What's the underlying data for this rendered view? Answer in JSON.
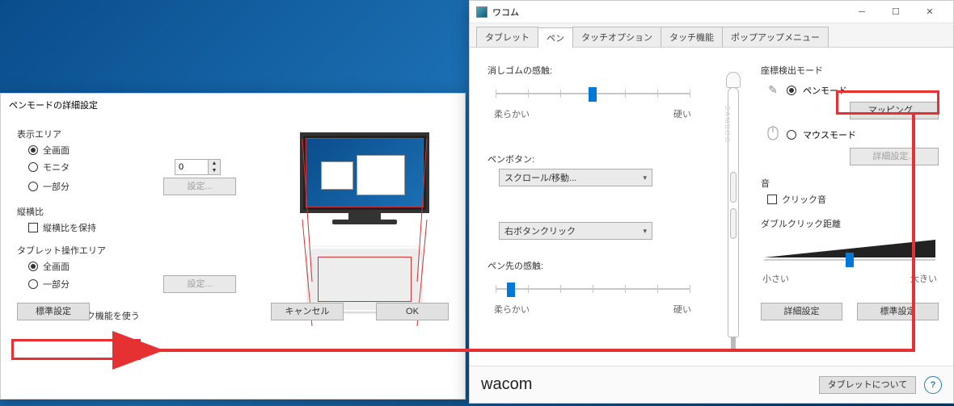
{
  "left_dialog": {
    "title": "ペンモードの詳細設定",
    "display_area": {
      "label": "表示エリア",
      "opt_fullscreen": "全画面",
      "opt_monitor": "モニタ",
      "opt_portion": "一部分",
      "monitor_index": "0",
      "settings_btn": "設定..."
    },
    "aspect": {
      "label": "縦横比",
      "keep": "縦横比を保持"
    },
    "tablet_area": {
      "label": "タブレット操作エリア",
      "opt_full": "全画面",
      "opt_portion": "一部分",
      "settings_btn": "設定..."
    },
    "digital_ink": "デジタルインク機能を使う",
    "buttons": {
      "default": "標準設定",
      "cancel": "キャンセル",
      "ok": "OK"
    }
  },
  "right_window": {
    "title": "ワコム",
    "tabs": [
      "タブレット",
      "ペン",
      "タッチオプション",
      "タッチ機能",
      "ポップアップメニュー"
    ],
    "active_tab": 1,
    "eraser": {
      "label": "消しゴムの感触:",
      "soft": "柔らかい",
      "hard": "硬い"
    },
    "pen_buttons": {
      "label": "ペンボタン:",
      "opt1": "スクロール/移動...",
      "opt2": "右ボタンクリック"
    },
    "tip": {
      "label": "ペン先の感触:",
      "soft": "柔らかい",
      "hard": "硬い"
    },
    "mode": {
      "label": "座標検出モード",
      "pen": "ペンモード",
      "mouse": "マウスモード",
      "mapping_btn": "マッピング...",
      "detail_btn": "詳細設定..."
    },
    "sound": {
      "label": "音",
      "click_sound": "クリック音"
    },
    "dcd": {
      "label": "ダブルクリック距離",
      "small": "小さい",
      "large": "大きい"
    },
    "buttons": {
      "detail": "詳細設定",
      "default": "標準設定"
    },
    "footer": {
      "brand": "wacom",
      "about": "タブレットについて"
    }
  }
}
